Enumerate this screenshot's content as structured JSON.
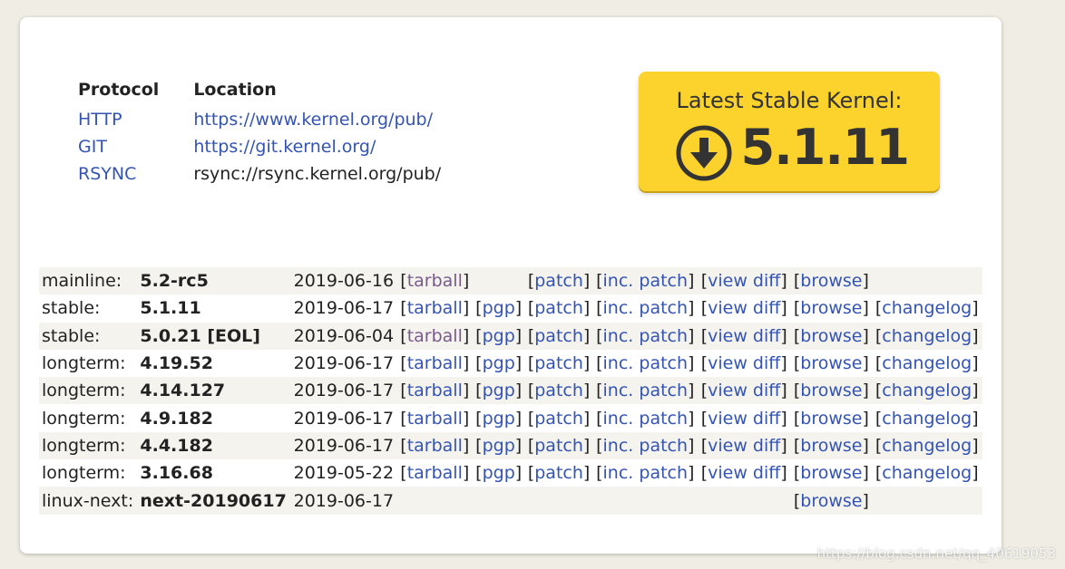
{
  "protocols": {
    "headers": [
      "Protocol",
      "Location"
    ],
    "rows": [
      {
        "protocol": "HTTP",
        "location": "https://www.kernel.org/pub/",
        "location_link": true
      },
      {
        "protocol": "GIT",
        "location": "https://git.kernel.org/",
        "location_link": true
      },
      {
        "protocol": "RSYNC",
        "location": "rsync://rsync.kernel.org/pub/",
        "location_link": false
      }
    ]
  },
  "latest": {
    "title": "Latest Stable Kernel:",
    "version": "5.1.11",
    "icon": "download-arrow-icon",
    "color": "#fcd22d"
  },
  "releases": [
    {
      "branch": "mainline:",
      "version": "5.2-rc5",
      "date": "2019-06-16",
      "tarball": "tarball",
      "tarball_visited": true,
      "pgp": "",
      "patch": "patch",
      "inc_patch": "inc. patch",
      "view_diff": "view diff",
      "browse": "browse",
      "changelog": ""
    },
    {
      "branch": "stable:",
      "version": "5.1.11",
      "date": "2019-06-17",
      "tarball": "tarball",
      "tarball_visited": false,
      "pgp": "pgp",
      "patch": "patch",
      "inc_patch": "inc. patch",
      "view_diff": "view diff",
      "browse": "browse",
      "changelog": "changelog"
    },
    {
      "branch": "stable:",
      "version": "5.0.21 [EOL]",
      "date": "2019-06-04",
      "tarball": "tarball",
      "tarball_visited": true,
      "pgp": "pgp",
      "patch": "patch",
      "inc_patch": "inc. patch",
      "view_diff": "view diff",
      "browse": "browse",
      "changelog": "changelog"
    },
    {
      "branch": "longterm:",
      "version": "4.19.52",
      "date": "2019-06-17",
      "tarball": "tarball",
      "tarball_visited": false,
      "pgp": "pgp",
      "patch": "patch",
      "inc_patch": "inc. patch",
      "view_diff": "view diff",
      "browse": "browse",
      "changelog": "changelog"
    },
    {
      "branch": "longterm:",
      "version": "4.14.127",
      "date": "2019-06-17",
      "tarball": "tarball",
      "tarball_visited": false,
      "pgp": "pgp",
      "patch": "patch",
      "inc_patch": "inc. patch",
      "view_diff": "view diff",
      "browse": "browse",
      "changelog": "changelog"
    },
    {
      "branch": "longterm:",
      "version": "4.9.182",
      "date": "2019-06-17",
      "tarball": "tarball",
      "tarball_visited": false,
      "pgp": "pgp",
      "patch": "patch",
      "inc_patch": "inc. patch",
      "view_diff": "view diff",
      "browse": "browse",
      "changelog": "changelog"
    },
    {
      "branch": "longterm:",
      "version": "4.4.182",
      "date": "2019-06-17",
      "tarball": "tarball",
      "tarball_visited": false,
      "pgp": "pgp",
      "patch": "patch",
      "inc_patch": "inc. patch",
      "view_diff": "view diff",
      "browse": "browse",
      "changelog": "changelog"
    },
    {
      "branch": "longterm:",
      "version": "3.16.68",
      "date": "2019-05-22",
      "tarball": "tarball",
      "tarball_visited": false,
      "pgp": "pgp",
      "patch": "patch",
      "inc_patch": "inc. patch",
      "view_diff": "view diff",
      "browse": "browse",
      "changelog": "changelog"
    },
    {
      "branch": "linux-next:",
      "version": "next-20190617",
      "date": "2019-06-17",
      "tarball": "",
      "tarball_visited": false,
      "pgp": "",
      "patch": "",
      "inc_patch": "",
      "view_diff": "",
      "browse": "browse",
      "changelog": ""
    }
  ],
  "watermark": "https://blog.csdn.net/qq_40619053",
  "colors": {
    "link": "#3454b4",
    "visited_link": "#7a5a8c",
    "page_bg": "#f0ede4"
  }
}
